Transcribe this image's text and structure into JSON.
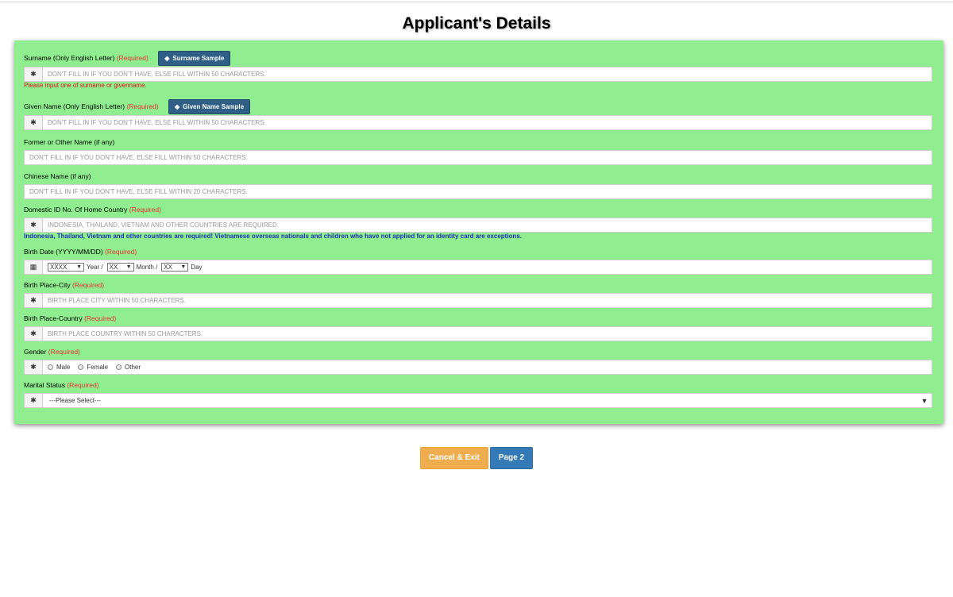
{
  "page_title": "Applicant's Details",
  "required_text": "(Required)",
  "fields": {
    "surname": {
      "label": "Surname (Only English Letter)",
      "button": "Surname Sample",
      "placeholder": "DON'T FILL IN IF YOU DON'T HAVE, ELSE FILL WITHIN 50 CHARACTERS.",
      "error": "Please input one of surname or givenname."
    },
    "given_name": {
      "label": "Given Name (Only English Letter)",
      "button": "Given Name Sample",
      "placeholder": "DON'T FILL IN IF YOU DON'T HAVE, ELSE FILL WITHIN 50 CHARACTERS."
    },
    "former_name": {
      "label": "Former or Other Name (if any)",
      "placeholder": "DON'T FILL IN IF YOU DON'T HAVE, ELSE FILL WITHIN 50 CHARACTERS."
    },
    "chinese_name": {
      "label": "Chinese Name (if any)",
      "placeholder": "DON'T FILL IN IF YOU DON'T HAVE, ELSE FILL WITHIN 20 CHARACTERS."
    },
    "domestic_id": {
      "label": "Domestic ID No. Of Home Country",
      "placeholder": "INDONESIA, THAILAND, VIETNAM AND OTHER COUNTRIES ARE REQUIRED.",
      "note": "Indonesia, Thailand, Vietnam and other countries are required! Vietnamese overseas nationals and children who have not applied for an identity card are exceptions."
    },
    "birth_date": {
      "label": "Birth Date (YYYY/MM/DD)",
      "year_value": "XXXX",
      "year_text": "Year /",
      "month_value": "XX",
      "month_text": "Month /",
      "day_value": "XX",
      "day_text": "Day"
    },
    "birth_city": {
      "label": "Birth Place-City",
      "placeholder": "BIRTH PLACE CITY WITHIN 50 CHARACTERS."
    },
    "birth_country": {
      "label": "Birth Place-Country",
      "placeholder": "BIRTH PLACE COUNTRY WITHIN 50 CHARACTERS."
    },
    "gender": {
      "label": "Gender",
      "options": [
        "Male",
        "Female",
        "Other"
      ]
    },
    "marital": {
      "label": "Marital Status",
      "selected": "---Please Select---"
    }
  },
  "icons": {
    "asterisk": "✱",
    "calendar": "▦",
    "tag": "◆",
    "dropdown": "▼"
  },
  "buttons": {
    "cancel": "Cancel & Exit",
    "next": "Page 2"
  },
  "colors": {
    "panel_bg": "#90ee90",
    "required": "#e8322e",
    "error": "#e3101a",
    "note": "#1a2fb3",
    "sample_button": "#2f5f86",
    "cancel_button": "#f0ad4e",
    "next_button": "#337ab7"
  }
}
